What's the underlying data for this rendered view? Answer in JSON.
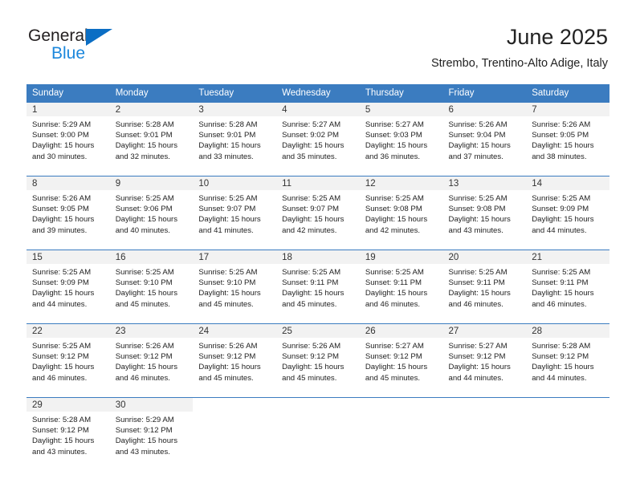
{
  "brand": {
    "name_top": "General",
    "name_bottom": "Blue",
    "triangle_color": "#0b6ec4",
    "top_color": "#231f20",
    "bottom_color": "#1b87dc"
  },
  "header": {
    "title": "June 2025",
    "subtitle": "Strembo, Trentino-Alto Adige, Italy"
  },
  "theme": {
    "header_blue": "#3b7cc0",
    "daynum_band": "#f2f2f2",
    "text": "#222222"
  },
  "calendar": {
    "weekday_headers": [
      "Sunday",
      "Monday",
      "Tuesday",
      "Wednesday",
      "Thursday",
      "Friday",
      "Saturday"
    ],
    "weeks": [
      [
        {
          "day": "1",
          "lines": [
            "Sunrise: 5:29 AM",
            "Sunset: 9:00 PM",
            "Daylight: 15 hours",
            "and 30 minutes."
          ]
        },
        {
          "day": "2",
          "lines": [
            "Sunrise: 5:28 AM",
            "Sunset: 9:01 PM",
            "Daylight: 15 hours",
            "and 32 minutes."
          ]
        },
        {
          "day": "3",
          "lines": [
            "Sunrise: 5:28 AM",
            "Sunset: 9:01 PM",
            "Daylight: 15 hours",
            "and 33 minutes."
          ]
        },
        {
          "day": "4",
          "lines": [
            "Sunrise: 5:27 AM",
            "Sunset: 9:02 PM",
            "Daylight: 15 hours",
            "and 35 minutes."
          ]
        },
        {
          "day": "5",
          "lines": [
            "Sunrise: 5:27 AM",
            "Sunset: 9:03 PM",
            "Daylight: 15 hours",
            "and 36 minutes."
          ]
        },
        {
          "day": "6",
          "lines": [
            "Sunrise: 5:26 AM",
            "Sunset: 9:04 PM",
            "Daylight: 15 hours",
            "and 37 minutes."
          ]
        },
        {
          "day": "7",
          "lines": [
            "Sunrise: 5:26 AM",
            "Sunset: 9:05 PM",
            "Daylight: 15 hours",
            "and 38 minutes."
          ]
        }
      ],
      [
        {
          "day": "8",
          "lines": [
            "Sunrise: 5:26 AM",
            "Sunset: 9:05 PM",
            "Daylight: 15 hours",
            "and 39 minutes."
          ]
        },
        {
          "day": "9",
          "lines": [
            "Sunrise: 5:25 AM",
            "Sunset: 9:06 PM",
            "Daylight: 15 hours",
            "and 40 minutes."
          ]
        },
        {
          "day": "10",
          "lines": [
            "Sunrise: 5:25 AM",
            "Sunset: 9:07 PM",
            "Daylight: 15 hours",
            "and 41 minutes."
          ]
        },
        {
          "day": "11",
          "lines": [
            "Sunrise: 5:25 AM",
            "Sunset: 9:07 PM",
            "Daylight: 15 hours",
            "and 42 minutes."
          ]
        },
        {
          "day": "12",
          "lines": [
            "Sunrise: 5:25 AM",
            "Sunset: 9:08 PM",
            "Daylight: 15 hours",
            "and 42 minutes."
          ]
        },
        {
          "day": "13",
          "lines": [
            "Sunrise: 5:25 AM",
            "Sunset: 9:08 PM",
            "Daylight: 15 hours",
            "and 43 minutes."
          ]
        },
        {
          "day": "14",
          "lines": [
            "Sunrise: 5:25 AM",
            "Sunset: 9:09 PM",
            "Daylight: 15 hours",
            "and 44 minutes."
          ]
        }
      ],
      [
        {
          "day": "15",
          "lines": [
            "Sunrise: 5:25 AM",
            "Sunset: 9:09 PM",
            "Daylight: 15 hours",
            "and 44 minutes."
          ]
        },
        {
          "day": "16",
          "lines": [
            "Sunrise: 5:25 AM",
            "Sunset: 9:10 PM",
            "Daylight: 15 hours",
            "and 45 minutes."
          ]
        },
        {
          "day": "17",
          "lines": [
            "Sunrise: 5:25 AM",
            "Sunset: 9:10 PM",
            "Daylight: 15 hours",
            "and 45 minutes."
          ]
        },
        {
          "day": "18",
          "lines": [
            "Sunrise: 5:25 AM",
            "Sunset: 9:11 PM",
            "Daylight: 15 hours",
            "and 45 minutes."
          ]
        },
        {
          "day": "19",
          "lines": [
            "Sunrise: 5:25 AM",
            "Sunset: 9:11 PM",
            "Daylight: 15 hours",
            "and 46 minutes."
          ]
        },
        {
          "day": "20",
          "lines": [
            "Sunrise: 5:25 AM",
            "Sunset: 9:11 PM",
            "Daylight: 15 hours",
            "and 46 minutes."
          ]
        },
        {
          "day": "21",
          "lines": [
            "Sunrise: 5:25 AM",
            "Sunset: 9:11 PM",
            "Daylight: 15 hours",
            "and 46 minutes."
          ]
        }
      ],
      [
        {
          "day": "22",
          "lines": [
            "Sunrise: 5:25 AM",
            "Sunset: 9:12 PM",
            "Daylight: 15 hours",
            "and 46 minutes."
          ]
        },
        {
          "day": "23",
          "lines": [
            "Sunrise: 5:26 AM",
            "Sunset: 9:12 PM",
            "Daylight: 15 hours",
            "and 46 minutes."
          ]
        },
        {
          "day": "24",
          "lines": [
            "Sunrise: 5:26 AM",
            "Sunset: 9:12 PM",
            "Daylight: 15 hours",
            "and 45 minutes."
          ]
        },
        {
          "day": "25",
          "lines": [
            "Sunrise: 5:26 AM",
            "Sunset: 9:12 PM",
            "Daylight: 15 hours",
            "and 45 minutes."
          ]
        },
        {
          "day": "26",
          "lines": [
            "Sunrise: 5:27 AM",
            "Sunset: 9:12 PM",
            "Daylight: 15 hours",
            "and 45 minutes."
          ]
        },
        {
          "day": "27",
          "lines": [
            "Sunrise: 5:27 AM",
            "Sunset: 9:12 PM",
            "Daylight: 15 hours",
            "and 44 minutes."
          ]
        },
        {
          "day": "28",
          "lines": [
            "Sunrise: 5:28 AM",
            "Sunset: 9:12 PM",
            "Daylight: 15 hours",
            "and 44 minutes."
          ]
        }
      ],
      [
        {
          "day": "29",
          "lines": [
            "Sunrise: 5:28 AM",
            "Sunset: 9:12 PM",
            "Daylight: 15 hours",
            "and 43 minutes."
          ]
        },
        {
          "day": "30",
          "lines": [
            "Sunrise: 5:29 AM",
            "Sunset: 9:12 PM",
            "Daylight: 15 hours",
            "and 43 minutes."
          ]
        },
        {
          "day": "",
          "lines": []
        },
        {
          "day": "",
          "lines": []
        },
        {
          "day": "",
          "lines": []
        },
        {
          "day": "",
          "lines": []
        },
        {
          "day": "",
          "lines": []
        }
      ]
    ]
  }
}
